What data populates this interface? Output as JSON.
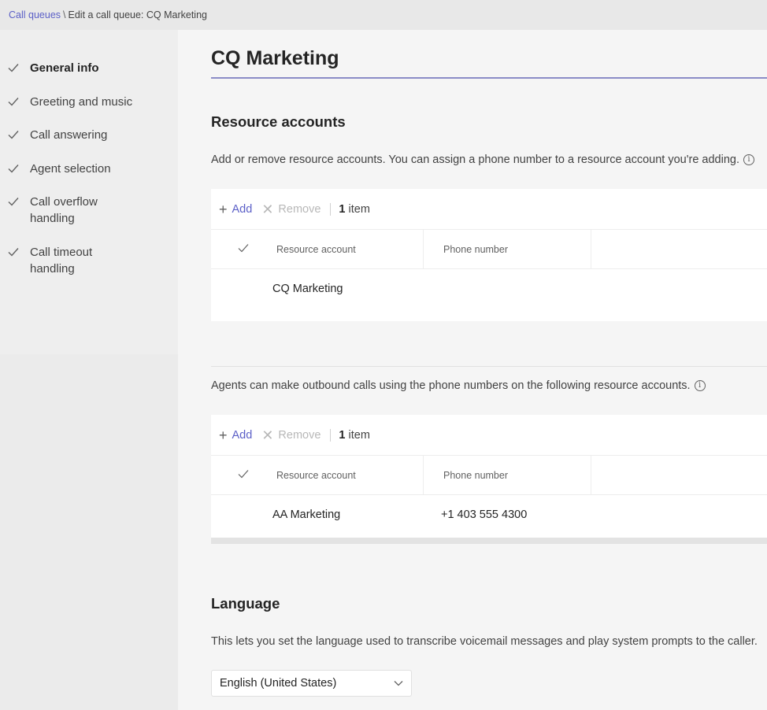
{
  "breadcrumb": {
    "parent": "Call queues",
    "separator": "\\",
    "current": "Edit a call queue: CQ Marketing"
  },
  "sidebar": {
    "items": [
      {
        "label": "General info",
        "done": true,
        "active": true
      },
      {
        "label": "Greeting and music",
        "done": true,
        "active": false
      },
      {
        "label": "Call answering",
        "done": true,
        "active": false
      },
      {
        "label": "Agent selection",
        "done": true,
        "active": false
      },
      {
        "label": "Call overflow",
        "label2": "handling",
        "done": true,
        "active": false
      },
      {
        "label": "Call timeout",
        "label2": "handling",
        "done": true,
        "active": false
      }
    ]
  },
  "page": {
    "title": "CQ Marketing"
  },
  "resource_accounts": {
    "heading": "Resource accounts",
    "description": "Add or remove resource accounts. You can assign a phone number to a resource account you're adding.",
    "toolbar": {
      "add": "Add",
      "remove": "Remove",
      "count_num": "1",
      "count_label": "item"
    },
    "columns": [
      "Resource account",
      "Phone number"
    ],
    "rows": [
      {
        "account": "CQ Marketing",
        "phone": ""
      }
    ]
  },
  "outbound": {
    "description": "Agents can make outbound calls using the phone numbers on the following resource accounts.",
    "toolbar": {
      "add": "Add",
      "remove": "Remove",
      "count_num": "1",
      "count_label": "item"
    },
    "columns": [
      "Resource account",
      "Phone number"
    ],
    "rows": [
      {
        "account": "AA Marketing",
        "phone": "+1 403 555 4300"
      }
    ]
  },
  "language": {
    "heading": "Language",
    "description": "This lets you set the language used to transcribe voicemail messages and play system prompts to the caller.",
    "selected": "English (United States)"
  },
  "icons": {
    "check": "check-icon",
    "add": "plus-icon",
    "remove": "close-icon",
    "info": "info-icon",
    "dropdown": "chevron-down-icon"
  },
  "colors": {
    "accent": "#5b5fc7",
    "title_rule": "#8b8cc7"
  }
}
